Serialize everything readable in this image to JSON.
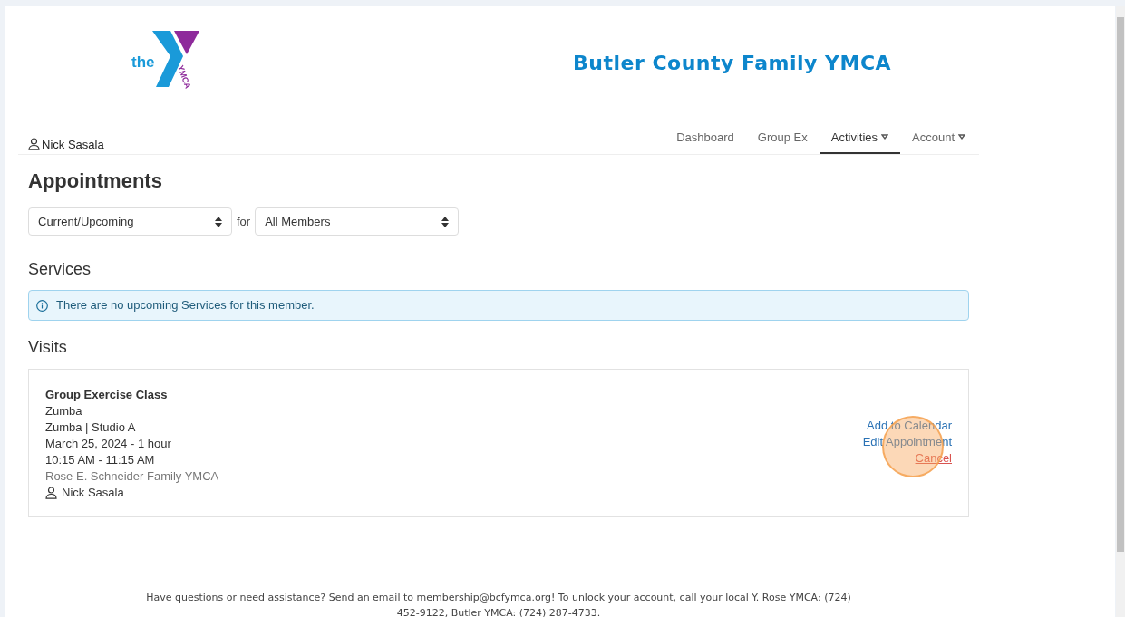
{
  "logo": {
    "prefix": "the",
    "wordmark": "YMCA"
  },
  "site_title": "Butler County Family YMCA",
  "user": {
    "name": "Nick Sasala"
  },
  "nav": [
    {
      "label": "Dashboard",
      "selected": false,
      "dropdown": false
    },
    {
      "label": "Group Ex",
      "selected": false,
      "dropdown": false
    },
    {
      "label": "Activities",
      "selected": true,
      "dropdown": true
    },
    {
      "label": "Account",
      "selected": false,
      "dropdown": true
    }
  ],
  "page_title": "Appointments",
  "filters": {
    "period": "Current/Upcoming",
    "joiner": "for",
    "member": "All Members"
  },
  "services": {
    "heading": "Services",
    "notice": "There are no upcoming Services for this member."
  },
  "visits": {
    "heading": "Visits",
    "items": [
      {
        "type": "Group Exercise Class",
        "name": "Zumba",
        "location": "Zumba | Studio A",
        "date": "March 25, 2024 - 1 hour",
        "time": "10:15 AM - 11:15 AM",
        "branch": "Rose E. Schneider Family YMCA",
        "member": "Nick Sasala",
        "actions": [
          {
            "label": "Add to Calendar",
            "kind": "link"
          },
          {
            "label": "Edit Appointment",
            "kind": "link"
          },
          {
            "label": "Cancel",
            "kind": "danger"
          }
        ]
      }
    ]
  },
  "footer": "Have questions or need assistance? Send an email to membership@bcfymca.org! To unlock your account, call your local Y. Rose YMCA: (724) 452-9122, Butler YMCA: (724) 287-4733."
}
